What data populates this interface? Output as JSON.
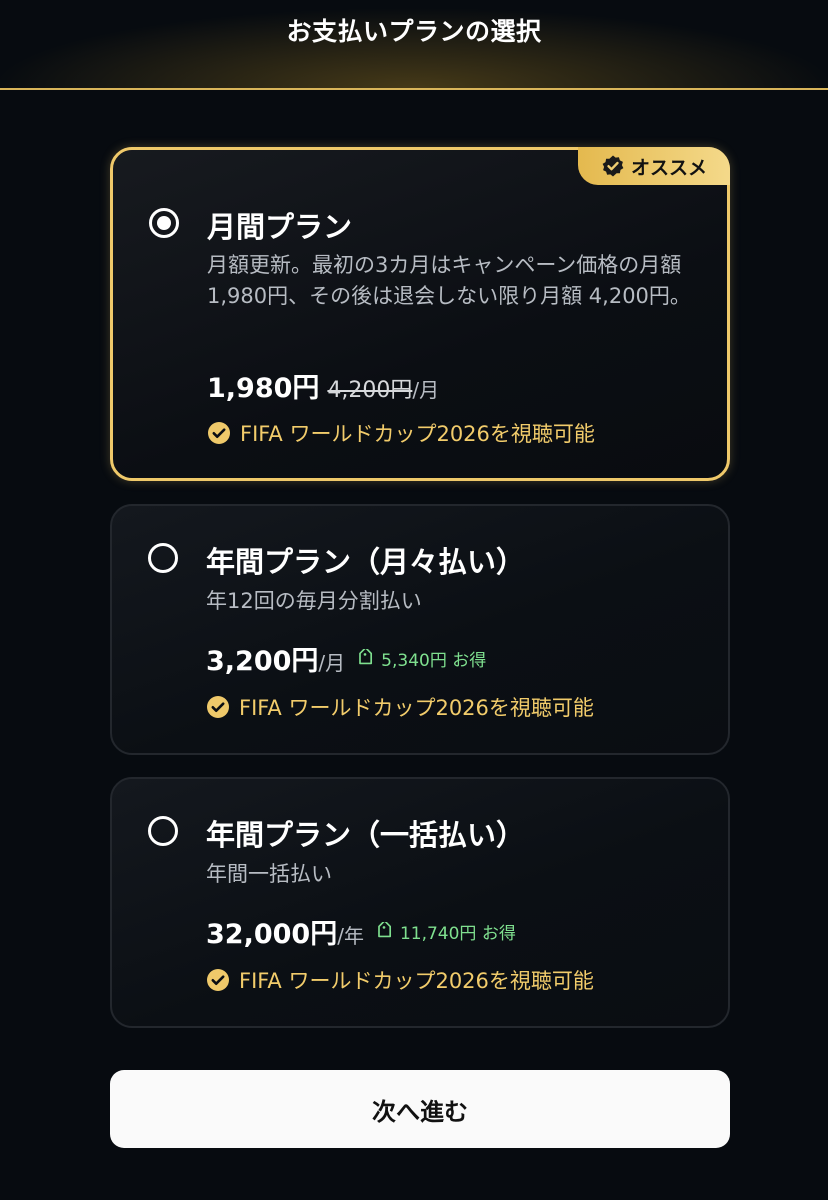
{
  "header": {
    "title": "お支払いプランの選択"
  },
  "plans": [
    {
      "name": "月間プラン",
      "description": "月額更新。最初の3カ月はキャンペーン価格の月額 1,980円、その後は退会しない限り月額 4,200円。",
      "price": "1,980円",
      "old_price": "4,200円",
      "unit": "/月",
      "feature": "FIFA ワールドカップ2026を視聴可能",
      "badge": "オススメ",
      "selected": true
    },
    {
      "name": "年間プラン（月々払い）",
      "description": "年12回の毎月分割払い",
      "price": "3,200円",
      "unit": "/月",
      "saving": "5,340円 お得",
      "feature": "FIFA ワールドカップ2026を視聴可能",
      "selected": false
    },
    {
      "name": "年間プラン（一括払い）",
      "description": "年間一括払い",
      "price": "32,000円",
      "unit": "/年",
      "saving": "11,740円 お得",
      "feature": "FIFA ワールドカップ2026を視聴可能",
      "selected": false
    }
  ],
  "footer": {
    "next_label": "次へ進む"
  },
  "colors": {
    "accent_gold": "#efc96a",
    "saving_green": "#7fe08f",
    "background": "#070b10"
  },
  "icons": {
    "badge": "verified-badge-icon",
    "radio": "radio-button-icon",
    "saving": "price-tag-icon",
    "feature": "check-circle-icon"
  }
}
